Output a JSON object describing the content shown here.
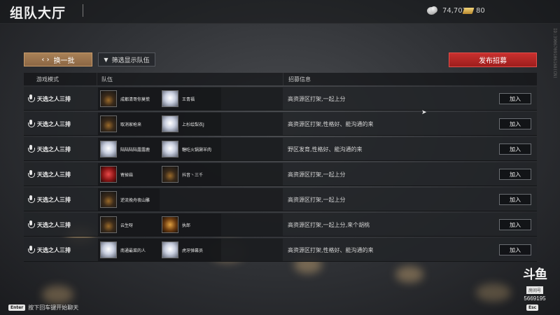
{
  "header": {
    "title": "组队大厅",
    "silver_amount": "74,702",
    "gold_amount": "80"
  },
  "side_code": "ID:3906709106168(CN)",
  "toolbar": {
    "refresh_label": "换一批",
    "filter_label": "筛选显示队伍",
    "publish_label": "发布招募"
  },
  "table": {
    "headers": {
      "mode": "游戏模式",
      "team": "队伍",
      "info": "招募信息"
    },
    "join_label": "加入",
    "rows": [
      {
        "mode": "天选之人三排",
        "members": [
          {
            "name": "成都清哥你莫慌",
            "avatar": "dark"
          },
          {
            "name": "王青福",
            "avatar": "light"
          },
          {
            "name": "",
            "avatar": "blank"
          }
        ],
        "info": "高资源区打架,一起上分"
      },
      {
        "mode": "天选之人三排",
        "members": [
          {
            "name": "取消家枪来",
            "avatar": "dark"
          },
          {
            "name": "上杉绘梨衣J",
            "avatar": "light"
          },
          {
            "name": "",
            "avatar": "blank"
          }
        ],
        "info": "高资源区打架,性格好、能沟通的来"
      },
      {
        "mode": "天选之人三排",
        "members": [
          {
            "name": "陆陆陆陆露露鹿",
            "avatar": "light"
          },
          {
            "name": "糖吃火锅涮羊肉",
            "avatar": "light"
          },
          {
            "name": "",
            "avatar": "blank"
          }
        ],
        "info": "野区发育,性格好、能沟通的来"
      },
      {
        "mode": "天选之人三排",
        "members": [
          {
            "name": "寄掉菇",
            "avatar": "red"
          },
          {
            "name": "抖音丶三千",
            "avatar": "dark"
          },
          {
            "name": "",
            "avatar": "blank"
          }
        ],
        "info": "高资源区打架,一起上分"
      },
      {
        "mode": "天选之人三排",
        "members": [
          {
            "name": "逆流挽舟夜山雕",
            "avatar": "dark"
          },
          {
            "name": "",
            "avatar": "blank"
          },
          {
            "name": "",
            "avatar": "blank"
          }
        ],
        "info": "高资源区打架,一起上分"
      },
      {
        "mode": "天选之人三排",
        "members": [
          {
            "name": "云生呀",
            "avatar": "dark"
          },
          {
            "name": "执郎",
            "avatar": "gold"
          },
          {
            "name": "",
            "avatar": "blank"
          }
        ],
        "info": "高资源区打架,一起上分,来个胡桃"
      },
      {
        "mode": "天选之人三排",
        "members": [
          {
            "name": "南通最菜的人",
            "avatar": "light"
          },
          {
            "name": "虎牙弹幕员",
            "avatar": "light"
          },
          {
            "name": "",
            "avatar": "blank"
          }
        ],
        "info": "高资源区打架,性格好、能沟通的来"
      }
    ]
  },
  "footer": {
    "enter_key": "Enter",
    "enter_hint": "按下回车键开始聊天",
    "esc_key": "Esc"
  },
  "watermark": {
    "logo": "斗鱼",
    "sub": "房间号",
    "room_number": "5669195"
  },
  "colors": {
    "accent_gold": "#a98157",
    "publish_red": "#c9302e",
    "row_bg": "#222428"
  },
  "icons": {
    "refresh": "refresh-arrows-icon",
    "filter": "filter-icon",
    "voice": "microphone-icon",
    "silver": "silver-coin-icon",
    "gold": "gold-bar-icon"
  }
}
